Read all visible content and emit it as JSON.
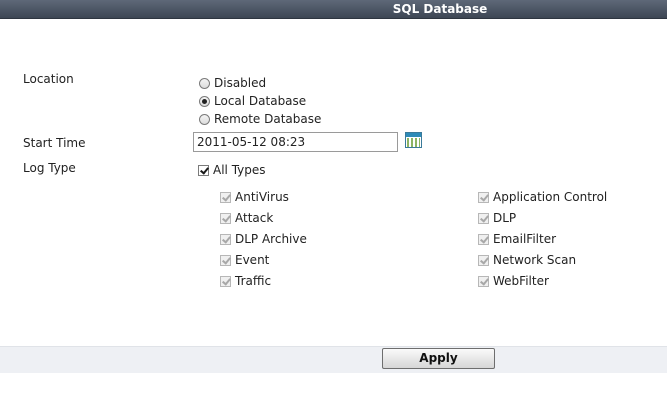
{
  "header": {
    "title": "SQL Database"
  },
  "location": {
    "label": "Location",
    "options": [
      {
        "label": "Disabled",
        "selected": false
      },
      {
        "label": "Local Database",
        "selected": true
      },
      {
        "label": "Remote Database",
        "selected": false
      }
    ]
  },
  "start_time": {
    "label": "Start Time",
    "value": "2011-05-12 08:23",
    "calendar_icon": "calendar-icon"
  },
  "log_type": {
    "label": "Log Type",
    "all_types": {
      "label": "All Types",
      "checked": true
    },
    "types_left": [
      "AntiVirus",
      "Attack",
      "DLP Archive",
      "Event",
      "Traffic"
    ],
    "types_right": [
      "Application Control",
      "DLP",
      "EmailFilter",
      "Network Scan",
      "WebFilter"
    ]
  },
  "footer": {
    "apply_label": "Apply"
  },
  "colors": {
    "header": "#4a5362",
    "footer_bar": "#eef0f4"
  }
}
